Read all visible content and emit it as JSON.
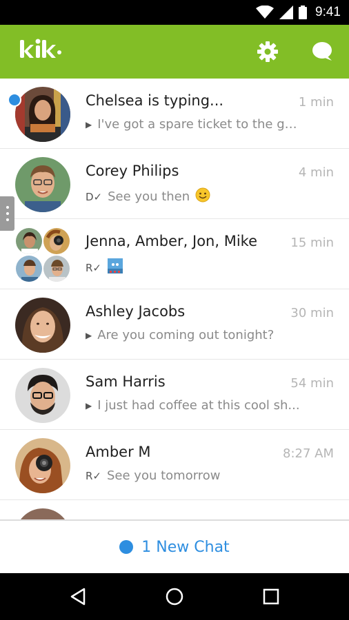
{
  "status_bar": {
    "time": "9:41",
    "icons": [
      "wifi-icon",
      "cell-signal-icon",
      "battery-icon"
    ]
  },
  "header": {
    "logo_text": "kik·",
    "brand_color": "#82be26",
    "icons": [
      "gear-icon",
      "compose-chat-icon"
    ]
  },
  "chats": [
    {
      "name": "Chelsea is typing...",
      "time": "1 min",
      "preview": "I've got a spare ticket to the ga...",
      "status": "play",
      "unread": true
    },
    {
      "name": "Corey Philips",
      "time": "4 min",
      "preview": "See you then",
      "status": "D✓",
      "emoji": "smiley-emoji-icon"
    },
    {
      "name": "Jenna, Amber, Jon, Mike",
      "time": "15 min",
      "preview": "",
      "status": "R✓",
      "attachment": "image-attachment-icon"
    },
    {
      "name": "Ashley Jacobs",
      "time": "30 min",
      "preview": "Are you coming out tonight?",
      "status": "play"
    },
    {
      "name": "Sam Harris",
      "time": "54 min",
      "preview": "I just had coffee at this cool sh...",
      "status": "play"
    },
    {
      "name": "Amber M",
      "time": "8:27 AM",
      "preview": "See you tomorrow",
      "status": "R✓"
    }
  ],
  "new_chat": {
    "label": "1 New Chat",
    "accent": "#2e8ee0"
  },
  "nav": [
    "back-icon",
    "home-icon",
    "recents-icon"
  ]
}
